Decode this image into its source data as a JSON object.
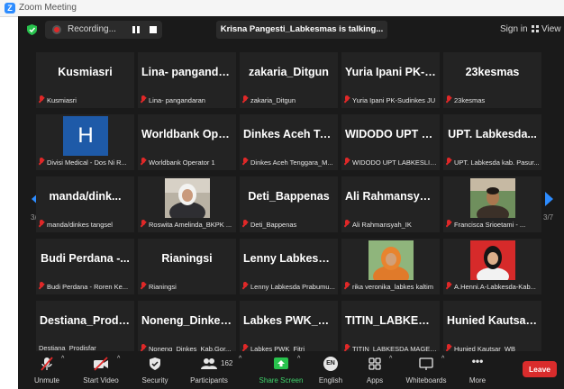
{
  "window": {
    "title": "Zoom Meeting"
  },
  "topbar": {
    "recording_label": "Recording...",
    "talking": "Krisna  Pangesti_Labkesmas is talking...",
    "signin": "Sign in",
    "view": "View"
  },
  "tiles": [
    {
      "big": "Kusmiasri",
      "foot": "Kusmiasri"
    },
    {
      "big": "Lina- panganda...",
      "foot": "Lina- pangandaran"
    },
    {
      "big": "zakaria_Ditgun",
      "foot": "zakaria_Ditgun"
    },
    {
      "big": "Yuria Ipani PK-S...",
      "foot": "Yuria Ipani PK-Sudinkes JU"
    },
    {
      "big": "23kesmas",
      "foot": "23kesmas"
    },
    {
      "big": "",
      "foot": "Divisi Medical - Dos Ni R...",
      "avatar": "H"
    },
    {
      "big": "Worldbank Ope...",
      "foot": "Worldbank Operator 1"
    },
    {
      "big": "Dinkes Aceh Te...",
      "foot": "Dinkes Aceh Tenggara_M..."
    },
    {
      "big": "WIDODO UPT L...",
      "foot": "WIDODO UPT LABKESLIN..."
    },
    {
      "big": "UPT. Labkesda...",
      "foot": "UPT. Labkesda kab. Pasur..."
    },
    {
      "big": "manda/dink...",
      "foot": "manda/dinkes tangsel"
    },
    {
      "big": "",
      "foot": "Roswita Amelinda_BKPK ...",
      "photo": "woman-hijab-white"
    },
    {
      "big": "Deti_Bappenas",
      "foot": "Deti_Bappenas"
    },
    {
      "big": "Ali Rahmansyah...",
      "foot": "Ali Rahmansyah_IK"
    },
    {
      "big": "",
      "foot": "Francisca Srioetami - ...",
      "photo": "man-outdoor"
    },
    {
      "big": "Budi Perdana -...",
      "foot": "Budi Perdana - Roren Ke..."
    },
    {
      "big": "Rianingsi",
      "foot": "Rianingsi"
    },
    {
      "big": "Lenny Labkesda...",
      "foot": "Lenny Labkesda Prabumu..."
    },
    {
      "big": "",
      "foot": "rika veronika_labkes kaltim",
      "photo": "woman-hijab-orange"
    },
    {
      "big": "",
      "foot": "A.Henni.A-Labkesda-Kab...",
      "photo": "woman-hijab-black"
    },
    {
      "big": "Destiana_Prodis...",
      "foot": "Destiana_Prodisfar",
      "nomic": true
    },
    {
      "big": "Noneng_Dinkes...",
      "foot": "Noneng_Dinkes_Kab.Gor..."
    },
    {
      "big": "Labkes PWK_Fitri",
      "foot": "Labkes PWK_Fitri"
    },
    {
      "big": "TITIN_LABKESD...",
      "foot": "TITIN_LABKESDA MAGET..."
    },
    {
      "big": "Hunied Kautsar...",
      "foot": "Hunied Kautsar_WB"
    }
  ],
  "pagination": {
    "left": "3/7",
    "right": "3/7"
  },
  "toolbar": {
    "unmute": "Unmute",
    "start_video": "Start Video",
    "security": "Security",
    "participants": "Participants",
    "participants_count": "162",
    "share_screen": "Share Screen",
    "english": "English",
    "english_badge": "EN",
    "apps": "Apps",
    "whiteboards": "Whiteboards",
    "more": "More",
    "leave": "Leave"
  },
  "colors": {
    "accent": "#2d8cff",
    "leave": "#d92c2c",
    "share": "#3fd36b",
    "muted": "#e02828"
  }
}
